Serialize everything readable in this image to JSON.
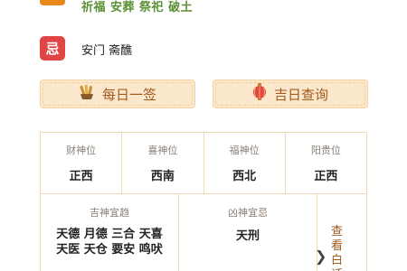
{
  "yi": {
    "items_text": "祈福 安葬 祭祀 破土"
  },
  "ji": {
    "badge": "忌",
    "items_text": "安门 斋醮"
  },
  "buttons": {
    "daily_sign": "每日一签",
    "lucky_day": "吉日查询"
  },
  "directions": [
    {
      "label": "财神位",
      "value": "正西"
    },
    {
      "label": "喜神位",
      "value": "西南"
    },
    {
      "label": "福神位",
      "value": "西北"
    },
    {
      "label": "阳贵位",
      "value": "正西"
    }
  ],
  "ji_shen": {
    "label": "吉神宜趋",
    "line1": "天德 月德 三合 天喜",
    "line2": "天医 天仓 要安 鸣吠"
  },
  "xiong_shen": {
    "label": "凶神宜忌",
    "value": "天刑"
  },
  "more": {
    "text": "查看白话",
    "chevron": "❯"
  },
  "colors": {
    "accent": "#a35a1c",
    "ji_red": "#e04545",
    "yi_orange": "#e8891b",
    "yi_green": "#5b8f33"
  }
}
